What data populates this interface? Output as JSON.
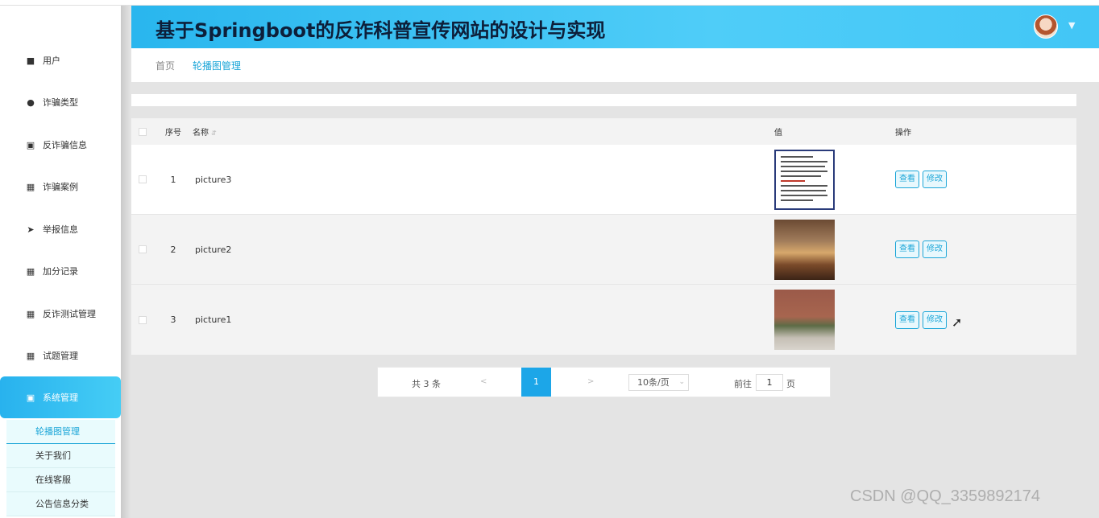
{
  "header": {
    "title": "基于Springboot的反诈科普宣传网站的设计与实现"
  },
  "sidebar": {
    "items": [
      {
        "label": "用户",
        "icon": "monitor-icon",
        "glyph": "■"
      },
      {
        "label": "诈骗类型",
        "icon": "location-pin-icon",
        "glyph": "●"
      },
      {
        "label": "反诈骗信息",
        "icon": "clipboard-icon",
        "glyph": "▣"
      },
      {
        "label": "诈骗案例",
        "icon": "grid-icon",
        "glyph": "▦"
      },
      {
        "label": "举报信息",
        "icon": "paper-plane-icon",
        "glyph": "➤"
      },
      {
        "label": "加分记录",
        "icon": "grid-icon",
        "glyph": "▦"
      },
      {
        "label": "反诈测试管理",
        "icon": "grid-icon",
        "glyph": "▦"
      },
      {
        "label": "试题管理",
        "icon": "grid-icon",
        "glyph": "▦"
      },
      {
        "label": "系统管理",
        "icon": "clipboard-check-icon",
        "glyph": "▣"
      }
    ],
    "submenu": [
      "轮播图管理",
      "关于我们",
      "在线客服",
      "公告信息分类"
    ]
  },
  "breadcrumb": {
    "home": "首页",
    "current": "轮播图管理"
  },
  "table": {
    "columns": {
      "index": "序号",
      "name": "名称",
      "value": "值",
      "action": "操作"
    },
    "rows": [
      {
        "index": "1",
        "name": "picture3",
        "image": "document-poster"
      },
      {
        "index": "2",
        "name": "picture2",
        "image": "classroom-interior"
      },
      {
        "index": "3",
        "name": "picture1",
        "image": "campus-building"
      }
    ],
    "view_label": "查看",
    "edit_label": "修改"
  },
  "pagination": {
    "total": "共 3 条",
    "prev": "<",
    "current": "1",
    "next": ">",
    "page_size": "10条/页",
    "goto_label": "前往",
    "goto_value": "1",
    "goto_unit": "页"
  },
  "watermark": "CSDN @QQ_3359892174",
  "colors": {
    "accent": "#1ca6d8",
    "header_gradient_start": "#29b6ee",
    "header_gradient_end": "#4fcdf8"
  }
}
